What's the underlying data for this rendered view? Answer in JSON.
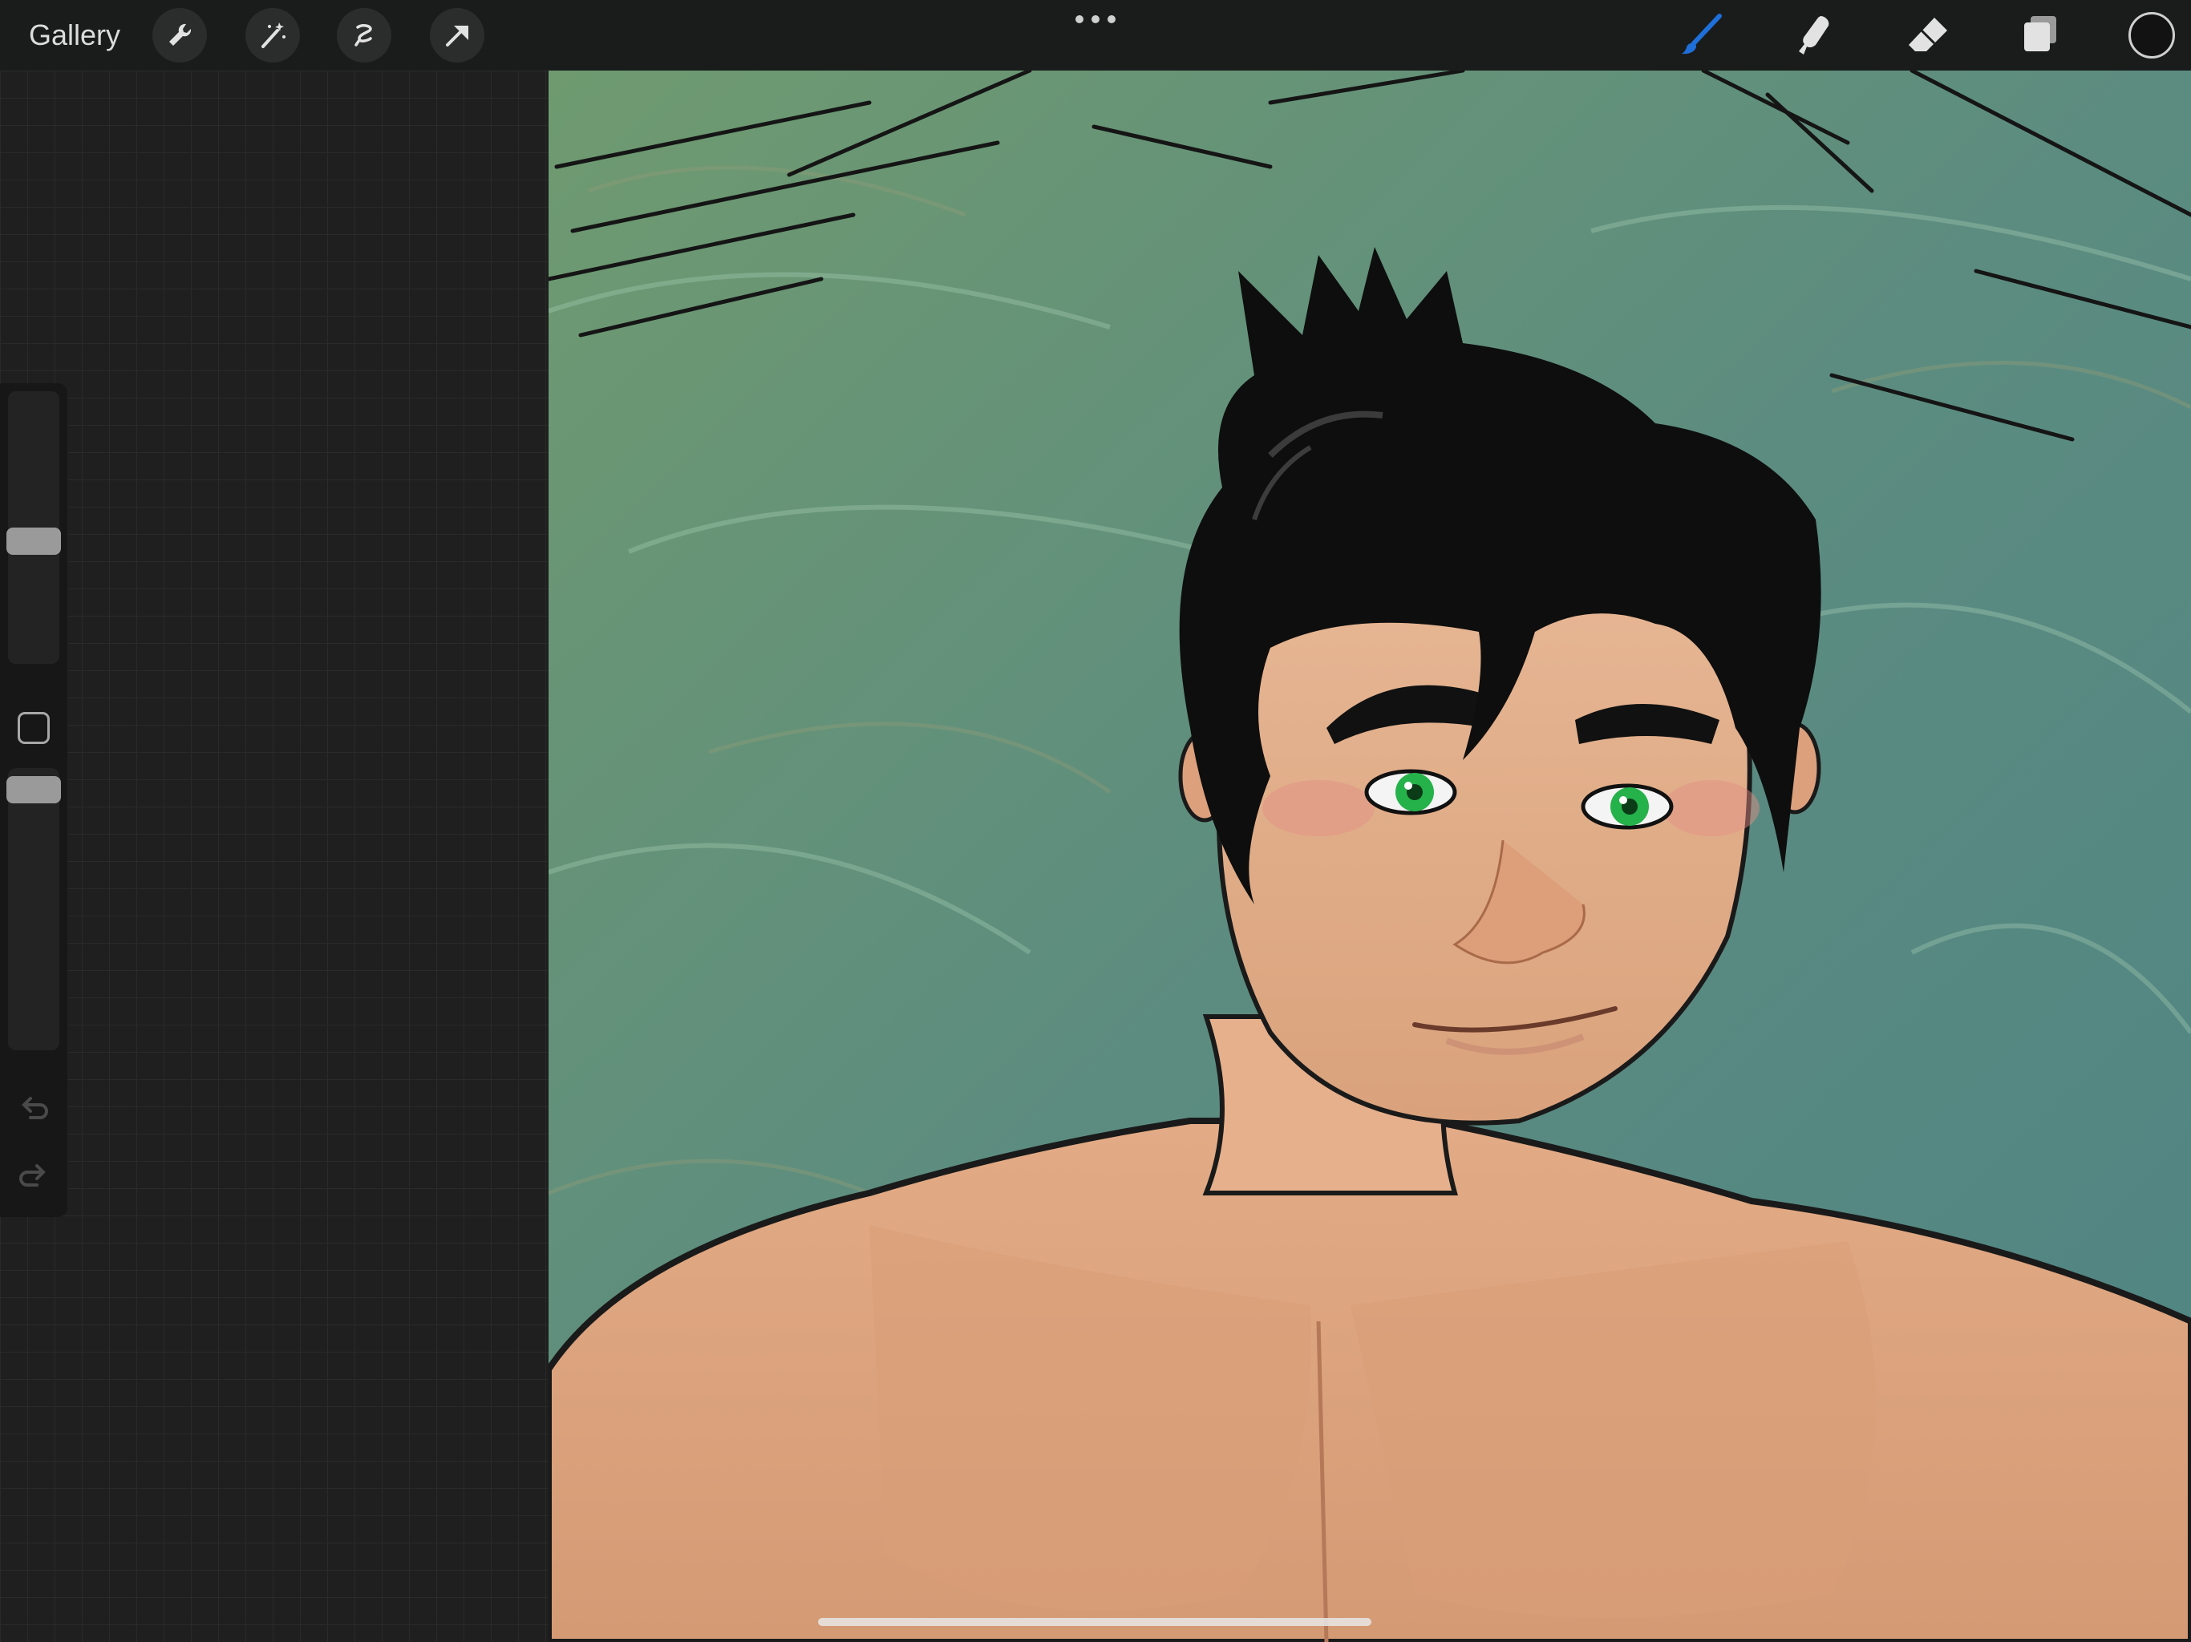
{
  "toolbar": {
    "gallery_label": "Gallery",
    "left_tools": [
      "wrench-icon",
      "magic-wand-icon",
      "selection-icon",
      "transform-arrow-icon"
    ],
    "right_tools": [
      "brush-icon",
      "smudge-icon",
      "eraser-icon",
      "layers-icon"
    ],
    "active_tool": "brush",
    "active_color": "#1e6fd9",
    "current_color": "#121212"
  },
  "sidebar": {
    "brush_size_level": 0.55,
    "opacity_level": 0.95,
    "icons": [
      "modify-square-icon",
      "undo-icon",
      "redo-icon"
    ]
  },
  "canvas": {
    "background_color": "#5e8a78",
    "subject": "illustration"
  }
}
